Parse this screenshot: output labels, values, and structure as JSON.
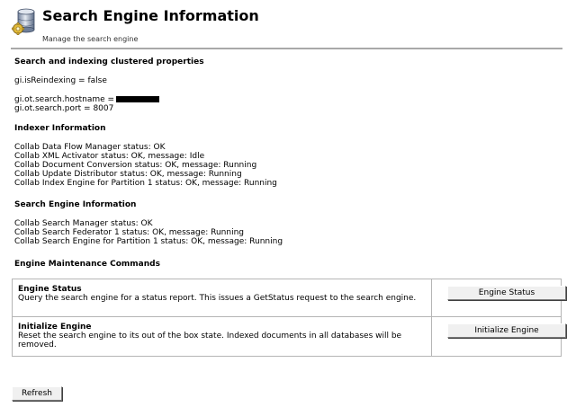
{
  "header": {
    "title": "Search Engine Information",
    "subtitle": "Manage the search engine",
    "icon": "database-gear-icon"
  },
  "sections": {
    "clustered": {
      "heading": "Search and indexing clustered properties",
      "reindexing": "gi.isReindexing = false",
      "hostname_label": "gi.ot.search.hostname =",
      "port": "gi.ot.search.port = 8007"
    },
    "indexer": {
      "heading": "Indexer Information",
      "lines": [
        "Collab Data Flow Manager status: OK",
        "Collab XML Activator status: OK, message: Idle",
        "Collab Document Conversion status: OK, message: Running",
        "Collab Update Distributor status: OK, message: Running",
        "Collab Index Engine for Partition 1 status: OK, message: Running"
      ]
    },
    "search_engine": {
      "heading": "Search Engine Information",
      "lines": [
        "Collab Search Manager status: OK",
        "Collab Search Federator 1 status: OK, message: Running",
        "Collab Search Engine for Partition 1 status: OK, message: Running"
      ]
    },
    "maintenance": {
      "heading": "Engine Maintenance Commands"
    }
  },
  "commands": [
    {
      "title": "Engine Status",
      "description": "Query the search engine for a status report. This issues a GetStatus request to the search engine.",
      "button_label": "Engine Status"
    },
    {
      "title": "Initialize Engine",
      "description": "Reset the search engine to its out of the box state. Indexed documents in all databases will be removed.",
      "button_label": "Initialize Engine"
    }
  ],
  "footer": {
    "refresh_label": "Refresh"
  }
}
